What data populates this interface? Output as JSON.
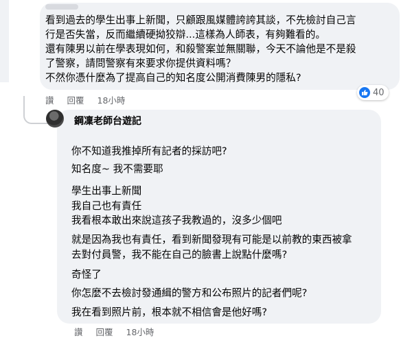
{
  "comment1": {
    "lines": [
      "看到過去的學生出事上新聞，只顧跟風媒體誇誇其談，不先檢討自己言",
      "行是否失當，反而繼續硬拗狡辯...這樣為人師表，有夠難看的。",
      "還有陳男以前在學表現如何，和殺警案並無關聯，今天不論他是不是殺",
      "了警察，請問警察有來要求你提供資料嗎？",
      "不然你憑什麼為了提高自己的知名度公開消費陳男的隱私?"
    ],
    "actions": {
      "like": "讚",
      "reply": "回覆",
      "time": "18小時"
    },
    "reaction_count": "40"
  },
  "comment2": {
    "author": "鋼凜老師台遊記",
    "lines": [
      "你不知道我推掉所有記者的採訪吧?",
      "知名度~ 我不需要耶",
      "學生出事上新聞",
      "我自己也有責任",
      "我看根本敢出來說這孩子我教過的，沒多少個吧",
      "就是因為我也有責任，看到新聞發現有可能是以前教的東西被拿",
      "去對付員警，我不能在自己的臉書上說點什麼嗎?",
      "奇怪了",
      "你怎麼不去檢討發通緝的警方和公布照片的記者們呢?",
      "我在看到照片前，根本就不相信會是他好嗎?"
    ],
    "actions": {
      "like": "讚",
      "reply": "回覆",
      "time": "18小時"
    }
  },
  "colors": {
    "bubble": "#f0f2f5",
    "like_blue": "#1877f2",
    "meta_gray": "#65676b"
  }
}
